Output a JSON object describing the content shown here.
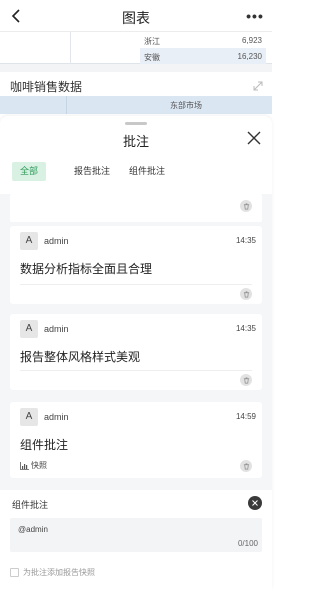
{
  "nav": {
    "title": "图表",
    "back_icon": "chevron-left-icon",
    "more_label": "•••"
  },
  "background_table": {
    "rows": [
      {
        "province": "浙江",
        "value": "6,923"
      },
      {
        "province": "安徽",
        "value": "16,230"
      }
    ]
  },
  "chart2": {
    "title": "咖啡销售数据",
    "header_market": "东部市场",
    "expand_icon": "expand-arrow-icon"
  },
  "sheet": {
    "title": "批注",
    "close_icon": "close-icon",
    "tabs": [
      {
        "label": "全部",
        "active": true
      },
      {
        "label": "报告批注",
        "active": false
      },
      {
        "label": "组件批注",
        "active": false
      }
    ]
  },
  "comments": [
    {
      "avatar": "A",
      "author": "admin",
      "time": "14:35",
      "text": "数据分析指标全面且合理"
    },
    {
      "avatar": "A",
      "author": "admin",
      "time": "14:35",
      "text": "报告整体风格样式美观"
    },
    {
      "avatar": "A",
      "author": "admin",
      "time": "14:59",
      "text": "组件批注",
      "snapshot_label": "快照"
    }
  ],
  "compose": {
    "label": "组件批注",
    "text": "@admin",
    "count": "0/100",
    "checkbox_label": "为批注添加报告快照"
  },
  "colors": {
    "accent_green": "#2e9a5b",
    "active_tab_bg": "#d9f1e3",
    "table_header_bg": "#dbe6f3"
  }
}
